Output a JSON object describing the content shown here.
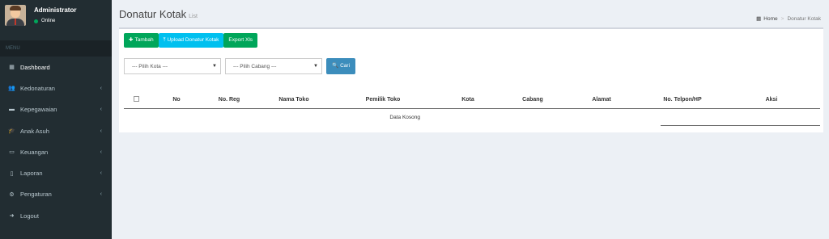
{
  "user": {
    "name": "Administrator",
    "status": "Online"
  },
  "sidebar": {
    "header": "MENU",
    "items": [
      {
        "label": "Dashboard",
        "icon": "dashboard-icon",
        "glyph": "▦",
        "chevron": ""
      },
      {
        "label": "Kedonaturan",
        "icon": "users-icon",
        "glyph": "👥",
        "chevron": "‹"
      },
      {
        "label": "Kepegawaian",
        "icon": "briefcase-icon",
        "glyph": "▬",
        "chevron": "‹"
      },
      {
        "label": "Anak Asuh",
        "icon": "graduation-cap-icon",
        "glyph": "🎓",
        "chevron": "‹"
      },
      {
        "label": "Keuangan",
        "icon": "money-icon",
        "glyph": "▭",
        "chevron": "‹"
      },
      {
        "label": "Laporan",
        "icon": "file-icon",
        "glyph": "▯",
        "chevron": "‹"
      },
      {
        "label": "Pengaturan",
        "icon": "cog-icon",
        "glyph": "⚙",
        "chevron": "‹"
      },
      {
        "label": "Logout",
        "icon": "sign-out-icon",
        "glyph": "➜",
        "chevron": ""
      }
    ]
  },
  "header": {
    "title": "Donatur Kotak",
    "subtitle": "List"
  },
  "breadcrumb": {
    "home": "Home",
    "current": "Donatur Kotak"
  },
  "toolbar": {
    "tambah": "Tambah",
    "upload": "Upload Donatur Kotak",
    "export": "Export Xls"
  },
  "filters": {
    "kota": "--- Pilih Kota ---",
    "cabang": "--- Pilih Cabang ---",
    "cari": "Cari"
  },
  "table": {
    "columns": [
      "No",
      "No. Reg",
      "Nama Toko",
      "Pemilik Toko",
      "Kota",
      "Cabang",
      "Alamat",
      "No. Telpon/HP",
      "Aksi"
    ],
    "empty": "Data Kosong"
  },
  "colors": {
    "sidebar": "#222d32",
    "green": "#00a65a",
    "aqua": "#00c0ef",
    "blue": "#3c8dbc"
  }
}
